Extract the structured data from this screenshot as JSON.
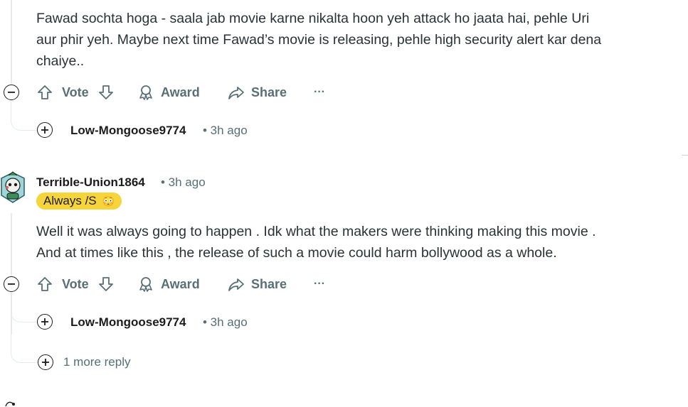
{
  "comment1": {
    "lines": [
      "Fawad sochta hoga - saala jab movie karne nikalta hoon yeh attack ho jaata hai, pehle Uri",
      "aur phir yeh. Maybe next time Fawad’s movie is releasing, pehle high security alert kar dena",
      "chaiye.."
    ],
    "actions": {
      "vote": "Vote",
      "award": "Award",
      "share": "Share",
      "more": "···"
    },
    "collapsed_reply": {
      "user": "Low-Mongoose9774",
      "time": "• 3h ago"
    }
  },
  "comment2": {
    "user": "Terrible-Union1864",
    "time": "• 3h ago",
    "flair": "Always /S",
    "flair_emoji": "😳",
    "lines": [
      "Well it was always going to happen . Idk what the makers were thinking making this movie .",
      "And at times like this , the release of such a movie could harm bollywood as a whole."
    ],
    "actions": {
      "vote": "Vote",
      "award": "Award",
      "share": "Share",
      "more": "···"
    },
    "collapsed_reply": {
      "user": "Low-Mongoose9774",
      "time": "• 3h ago"
    },
    "more_replies": "1 more reply"
  },
  "colors": {
    "text": "#2a3236",
    "meta": "#576f76",
    "flair": "#f6d43b",
    "thread": "#e5ebee"
  }
}
